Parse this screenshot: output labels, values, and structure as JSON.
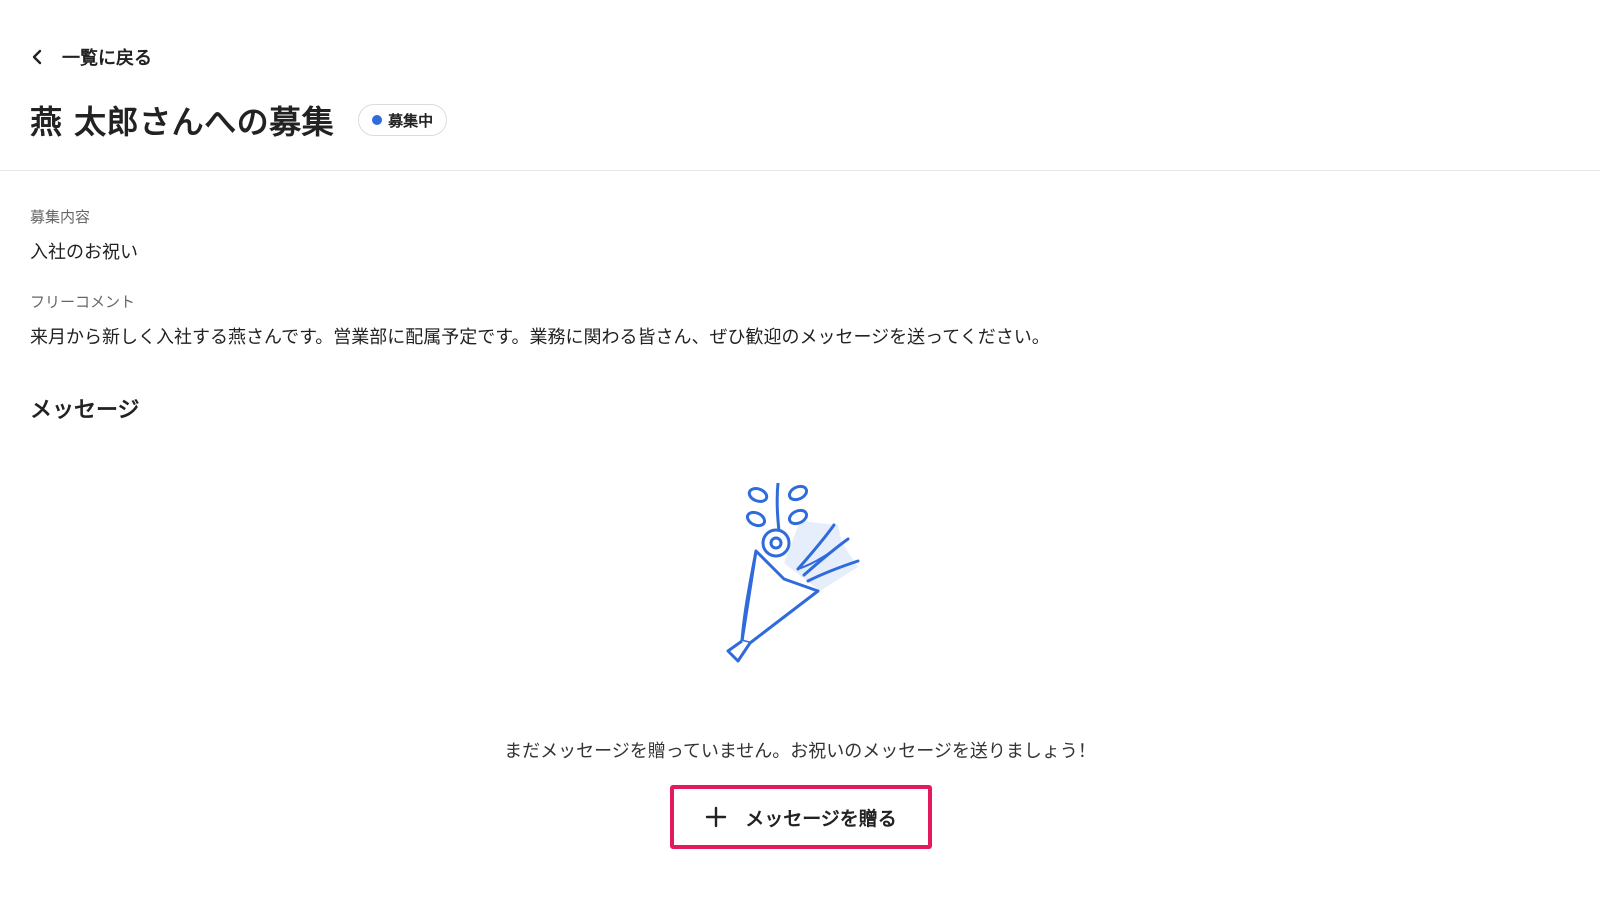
{
  "header": {
    "back_label": "一覧に戻る",
    "title": "燕 太郎さんへの募集",
    "status_badge": "募集中"
  },
  "details": {
    "content_label": "募集内容",
    "content_value": "入社のお祝い",
    "comment_label": "フリーコメント",
    "comment_value": "来月から新しく入社する燕さんです。営業部に配属予定です。業務に関わる皆さん、ぜひ歓迎のメッセージを送ってください。"
  },
  "messages": {
    "section_title": "メッセージ",
    "empty_text": "まだメッセージを贈っていません。お祝いのメッセージを送りましょう！",
    "send_button_label": "メッセージを贈る"
  },
  "colors": {
    "accent_blue": "#2f6bdb",
    "highlight_pink": "#e5195f",
    "illustration_fill": "#e6eefb"
  },
  "icons": {
    "back": "chevron-left-icon",
    "status": "status-dot-icon",
    "illustration": "bouquet-icon",
    "add": "plus-icon"
  }
}
